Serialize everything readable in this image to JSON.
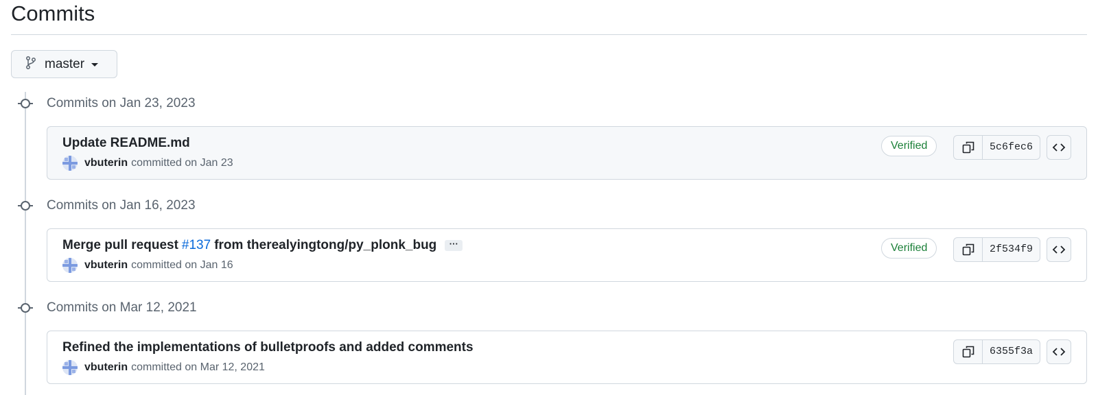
{
  "page": {
    "title": "Commits"
  },
  "branch": {
    "name": "master"
  },
  "groups": [
    {
      "label": "Commits on Jan 23, 2023",
      "commit": {
        "title": "Update README.md",
        "author": "vbuterin",
        "committed": "committed on Jan 23",
        "verified": "Verified",
        "sha": "5c6fec6"
      }
    },
    {
      "label": "Commits on Jan 16, 2023",
      "commit": {
        "title_prefix": "Merge pull request",
        "pr": "#137",
        "title_suffix": "from therealyingtong/py_plonk_bug",
        "ellipsis": "···",
        "author": "vbuterin",
        "committed": "committed on Jan 16",
        "verified": "Verified",
        "sha": "2f534f9"
      }
    },
    {
      "label": "Commits on Mar 12, 2021",
      "commit": {
        "title": "Refined the implementations of bulletproofs and added comments",
        "author": "vbuterin",
        "committed": "committed on Mar 12, 2021",
        "sha": "6355f3a"
      }
    }
  ],
  "icons": {
    "branch": "git-branch-icon",
    "copy": "copy-icon",
    "browse": "code-brackets-icon",
    "commit_node": "git-commit-icon"
  },
  "colors": {
    "verified": "#1a7f37",
    "link": "#0969da",
    "border": "#d0d7de",
    "muted": "#59636e"
  }
}
